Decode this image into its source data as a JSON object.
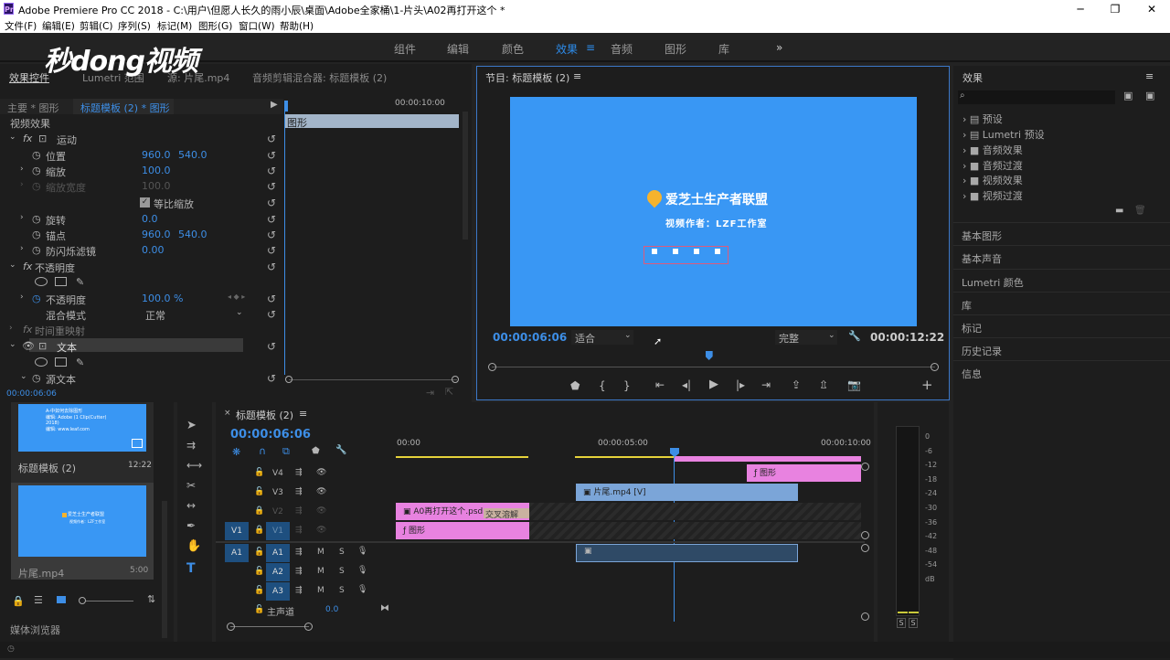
{
  "titlebar": {
    "app_icon": "Pr",
    "title": "Adobe Premiere Pro CC 2018 - C:\\用户\\但愿人长久的雨小辰\\桌面\\Adobe全家桶\\1-片头\\A02再打开这个 *"
  },
  "window_controls": {
    "minimize": "─",
    "maximize": "❐",
    "close": "✕"
  },
  "menu": [
    "文件(F)",
    "编辑(E)",
    "剪辑(C)",
    "序列(S)",
    "标记(M)",
    "图形(G)",
    "窗口(W)",
    "帮助(H)"
  ],
  "workspaces": {
    "items": [
      "组件",
      "编辑",
      "颜色",
      "效果",
      "音频",
      "图形",
      "库"
    ],
    "active": "效果",
    "more": "»",
    "active_menu": "≡"
  },
  "watermark": "秒dong视频",
  "effect_controls": {
    "tabs": [
      "效果控件",
      "Lumetri 范围",
      "源: 片尾.mp4",
      "音频剪辑混合器: 标题模板 (2)"
    ],
    "clip_path": "主要 * 图形",
    "clip_sel": "标题模板 (2) * 图形",
    "ruler_time": "00:00:10:00",
    "track_clip": "图形",
    "section": "视频效果",
    "rows": [
      {
        "label": "运动"
      },
      {
        "label": "位置",
        "v1": "960.0",
        "v2": "540.0"
      },
      {
        "label": "缩放",
        "v1": "100.0"
      },
      {
        "label": "缩放宽度",
        "v1": "100.0"
      },
      {
        "label": "等比缩放"
      },
      {
        "label": "旋转",
        "v1": "0.0"
      },
      {
        "label": "锚点",
        "v1": "960.0",
        "v2": "540.0"
      },
      {
        "label": "防闪烁滤镜",
        "v1": "0.00"
      },
      {
        "label": "不透明度"
      },
      {
        "label": "不透明度",
        "v1": "100.0 %"
      },
      {
        "label": "混合模式",
        "v1": "正常"
      },
      {
        "label": "时间重映射"
      },
      {
        "label": "文本"
      },
      {
        "label": "源文本"
      }
    ],
    "timecode": "00:00:06:06"
  },
  "program": {
    "title": "节目: 标题模板 (2)",
    "menu": "≡",
    "brand_text": "爱芝士生产者联盟",
    "sub_text": "视频作者：LZF工作室",
    "timecode": "00:00:06:06",
    "fit": "适合",
    "quality": "完整",
    "duration": "00:00:12:22",
    "playhead_fraction": 0.49
  },
  "effects": {
    "title": "效果",
    "menu": "≡",
    "search_placeholder": "",
    "tree": [
      "预设",
      "Lumetri 预设",
      "音频效果",
      "音频过渡",
      "视频效果",
      "视频过渡"
    ],
    "sections": [
      "基本图形",
      "基本声音",
      "Lumetri 颜色",
      "库",
      "标记",
      "历史记录",
      "信息"
    ]
  },
  "project": {
    "items": [
      {
        "name": "标题模板 (2)",
        "duration": "12:22"
      },
      {
        "name": "片尾.mp4",
        "duration": "5:00"
      }
    ],
    "thumb1_lines": [
      "A-中如何去除图形",
      "编辑: Adobe (1 Clip(Cutter) 2018)",
      "编辑: www.leaf.com"
    ],
    "thumb2_brand": "爱芝士生产者联盟",
    "thumb2_sub": "视频作者：LZF工作室",
    "browser": "媒体浏览器"
  },
  "timeline": {
    "title": "标题模板 (2)",
    "menu": "≡",
    "close": "×",
    "timecode": "00:00:06:06",
    "ruler": [
      "00:00",
      "00:00:05:00",
      "00:00:10:00"
    ],
    "tracks": [
      {
        "name": "V4"
      },
      {
        "name": "V3"
      },
      {
        "name": "V2"
      },
      {
        "name": "V1",
        "src": "V1"
      },
      {
        "name": "A1",
        "src": "A1",
        "m": "M",
        "s": "S"
      },
      {
        "name": "A2",
        "m": "M",
        "s": "S"
      },
      {
        "name": "A3",
        "m": "M",
        "s": "S"
      }
    ],
    "master": "主声道",
    "master_value": "0.0",
    "clips": {
      "graphic_v4": "图形",
      "tail_v3": "片尾.mp4 [V]",
      "psd_v2": "A0再打开这个.psd",
      "transition": "交叉溶解",
      "graphic_v1": "图形"
    }
  },
  "meter": {
    "scale": [
      "0",
      "-6",
      "-12",
      "-18",
      "-24",
      "-30",
      "-36",
      "-42",
      "-48",
      "-54",
      "dB"
    ],
    "solo": [
      "S",
      "S"
    ]
  },
  "colors": {
    "accent": "#2d8ceb",
    "program_bg": "#3997f4",
    "graphic_clip": "#e882e0",
    "video_clip": "#7ba5d8"
  }
}
